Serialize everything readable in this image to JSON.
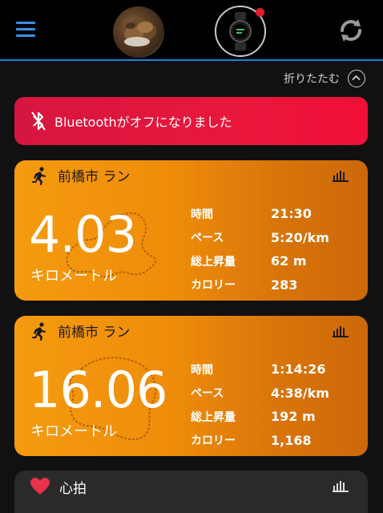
{
  "header": {
    "menu_icon": "hamburger-menu-icon",
    "avatar_icon": "profile-avatar",
    "watch_icon": "smartwatch-icon",
    "notification_color": "#e01b2e",
    "sync_icon": "sync-icon",
    "accent_color": "#1e7fd8"
  },
  "collapse": {
    "label": "折りたたむ",
    "icon": "chevron-up-icon"
  },
  "bluetooth_banner": {
    "icon": "bluetooth-off-icon",
    "text": "Bluetoothがオフになりました",
    "color": "#e8173c"
  },
  "activities": [
    {
      "icon": "running-icon",
      "title": "前橋市 ラン",
      "distance": "4.03",
      "unit": "キロメートル",
      "metrics": [
        {
          "label": "時間",
          "value": "21:30"
        },
        {
          "label": "ペース",
          "value": "5:20/km"
        },
        {
          "label": "総上昇量",
          "value": "62 m"
        },
        {
          "label": "カロリー",
          "value": "283"
        }
      ]
    },
    {
      "icon": "running-icon",
      "title": "前橋市 ラン",
      "distance": "16.06",
      "unit": "キロメートル",
      "metrics": [
        {
          "label": "時間",
          "value": "1:14:26"
        },
        {
          "label": "ペース",
          "value": "4:38/km"
        },
        {
          "label": "総上昇量",
          "value": "192 m"
        },
        {
          "label": "カロリー",
          "value": "1,168"
        }
      ]
    }
  ],
  "heart_rate": {
    "icon": "heart-icon",
    "title": "心拍",
    "color": "#e8334a"
  },
  "card_color": "#ee8c0a"
}
